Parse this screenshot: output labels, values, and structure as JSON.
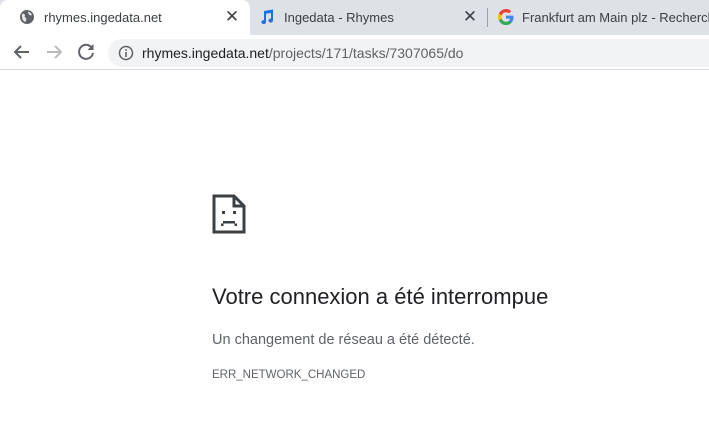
{
  "tabs": [
    {
      "title": "rhymes.ingedata.net",
      "favicon": "globe-icon",
      "active": true
    },
    {
      "title": "Ingedata - Rhymes",
      "favicon": "music-note-icon",
      "active": false
    },
    {
      "title": "Frankfurt am Main plz - Recherch",
      "favicon": "google-icon",
      "active": false
    }
  ],
  "toolbar": {
    "url_domain": "rhymes.ingedata.net",
    "url_path": "/projects/171/tasks/7307065/do"
  },
  "error": {
    "icon": "sad-page-icon",
    "title": "Votre connexion a été interrompue",
    "description": "Un changement de réseau a été détecté.",
    "code": "ERR_NETWORK_CHANGED"
  },
  "colors": {
    "tabstrip_bg": "#dee1e6",
    "omnibox_bg": "#f1f3f4",
    "music_icon": "#1a73e8"
  }
}
